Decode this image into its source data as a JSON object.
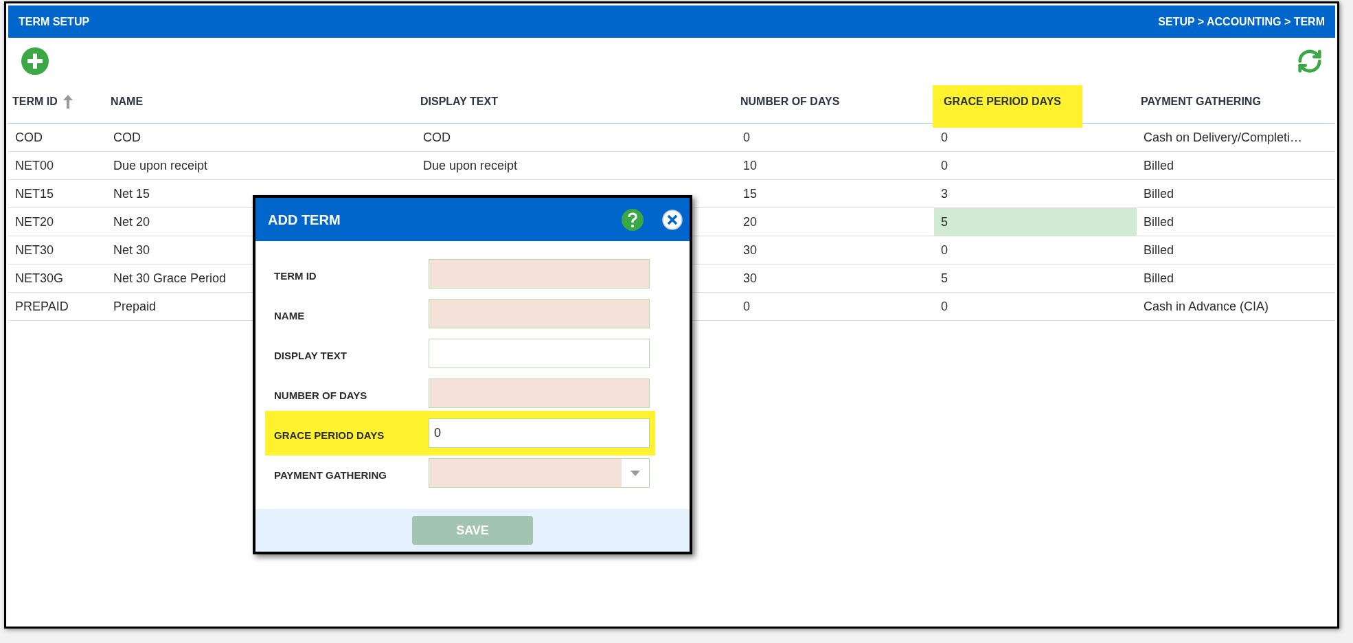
{
  "header": {
    "title": "TERM SETUP",
    "breadcrumb": "SETUP > ACCOUNTING > TERM"
  },
  "table": {
    "columns": [
      {
        "label": "TERM ID",
        "sorted": true,
        "highlighted": false
      },
      {
        "label": "NAME",
        "sorted": false,
        "highlighted": false
      },
      {
        "label": "DISPLAY TEXT",
        "sorted": false,
        "highlighted": false
      },
      {
        "label": "NUMBER OF DAYS",
        "sorted": false,
        "highlighted": false
      },
      {
        "label": "GRACE PERIOD DAYS",
        "sorted": false,
        "highlighted": true
      },
      {
        "label": "PAYMENT GATHERING",
        "sorted": false,
        "highlighted": false
      }
    ],
    "rows": [
      {
        "term_id": "COD",
        "name": "COD",
        "display_text": "COD",
        "number_of_days": "0",
        "grace_period_days": "0",
        "payment_gathering": "Cash on Delivery/Completi…",
        "grace_highlighted": false
      },
      {
        "term_id": "NET00",
        "name": "Due upon receipt",
        "display_text": "Due upon receipt",
        "number_of_days": "10",
        "grace_period_days": "0",
        "payment_gathering": "Billed",
        "grace_highlighted": false
      },
      {
        "term_id": "NET15",
        "name": "Net 15",
        "number_of_days": "15",
        "grace_period_days": "3",
        "payment_gathering": "Billed",
        "grace_highlighted": false
      },
      {
        "term_id": "NET20",
        "name": "Net 20",
        "number_of_days": "20",
        "grace_period_days": "5",
        "payment_gathering": "Billed",
        "grace_highlighted": true
      },
      {
        "term_id": "NET30",
        "name": "Net 30",
        "number_of_days": "30",
        "grace_period_days": "0",
        "payment_gathering": "Billed",
        "grace_highlighted": false
      },
      {
        "term_id": "NET30G",
        "name": "Net 30 Grace Period",
        "number_of_days": "30",
        "grace_period_days": "5",
        "payment_gathering": "Billed",
        "grace_highlighted": false
      },
      {
        "term_id": "PREPAID",
        "name": "Prepaid",
        "number_of_days": "0",
        "grace_period_days": "0",
        "payment_gathering": "Cash in Advance (CIA)",
        "grace_highlighted": false
      }
    ]
  },
  "dialog": {
    "title": "ADD TERM",
    "fields": [
      {
        "label": "TERM ID",
        "kind": "text",
        "required": true,
        "highlighted": false
      },
      {
        "label": "NAME",
        "kind": "text",
        "required": true,
        "highlighted": false
      },
      {
        "label": "DISPLAY TEXT",
        "kind": "text",
        "required": false,
        "highlighted": false
      },
      {
        "label": "NUMBER OF DAYS",
        "kind": "text",
        "required": true,
        "highlighted": false
      },
      {
        "label": "GRACE PERIOD DAYS",
        "kind": "text",
        "required": false,
        "highlighted": true,
        "value": "0"
      },
      {
        "label": "PAYMENT GATHERING",
        "kind": "select",
        "required": true,
        "highlighted": false
      }
    ],
    "save_button": {
      "label": "SAVE",
      "disabled": true
    }
  }
}
